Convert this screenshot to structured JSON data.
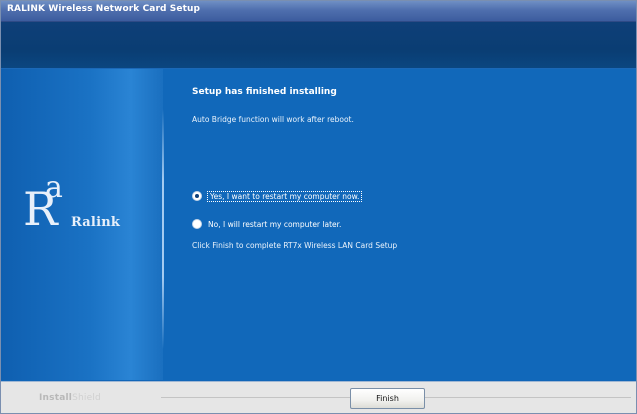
{
  "window": {
    "title": "RALINK Wireless Network Card Setup"
  },
  "brand": {
    "logo_text": "Ralink",
    "footer_brand_bold": "Install",
    "footer_brand_light": "Shield"
  },
  "content": {
    "heading": "Setup has finished installing",
    "subtext": "Auto Bridge function will work after reboot.",
    "restart_options": [
      {
        "label": "Yes, I want to restart my computer now.",
        "selected": true
      },
      {
        "label": "No, I will restart my computer later.",
        "selected": false
      }
    ],
    "finish_instruction": "Click Finish to complete RT7x Wireless LAN Card Setup"
  },
  "buttons": {
    "finish_label": "Finish"
  },
  "colors": {
    "title_bar": "#4f6fae",
    "header_band": "#0a3d73",
    "main_background": "#1168ba",
    "footer_background": "#e6e6e6"
  },
  "icons": {
    "logo": "ralink-logo-icon",
    "radio_selected": "radio-checked-icon",
    "radio_unselected": "radio-unchecked-icon"
  }
}
